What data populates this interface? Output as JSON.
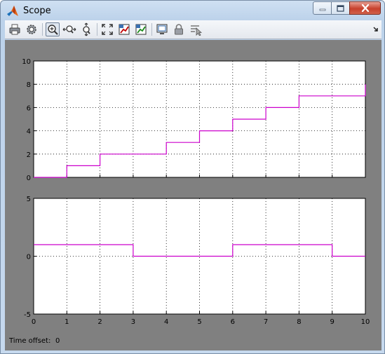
{
  "window": {
    "title": "Scope"
  },
  "toolbar": {
    "buttons": [
      {
        "icon": "print-icon"
      },
      {
        "icon": "parameters-icon"
      },
      {
        "icon": "zoom-icon"
      },
      {
        "icon": "zoom-x-icon"
      },
      {
        "icon": "zoom-y-icon"
      },
      {
        "icon": "autoscale-icon"
      },
      {
        "icon": "save-axes-icon"
      },
      {
        "icon": "restore-axes-icon"
      },
      {
        "icon": "floating-scope-icon"
      },
      {
        "icon": "lock-axes-icon"
      },
      {
        "icon": "signal-selection-icon"
      },
      {
        "icon": "dock-arrow-icon"
      }
    ]
  },
  "status": {
    "time_offset_label": "Time offset:",
    "time_offset_value": "0"
  },
  "colors": {
    "plot_background": "#ffffff",
    "figure_background": "#808080",
    "signal": "#cc00cc"
  },
  "chart_data": [
    {
      "type": "line",
      "step": true,
      "x": [
        0,
        1,
        2,
        3,
        4,
        5,
        6,
        7,
        8,
        9,
        10
      ],
      "series": [
        {
          "values": [
            0,
            1,
            2,
            2,
            3,
            4,
            5,
            6,
            7,
            7,
            8
          ]
        }
      ],
      "xlim": [
        0,
        10
      ],
      "ylim": [
        0,
        10
      ],
      "yticks": [
        "0",
        "2",
        "4",
        "6",
        "8",
        "10"
      ],
      "grid": true
    },
    {
      "type": "line",
      "step": true,
      "x": [
        0,
        1,
        2,
        3,
        4,
        5,
        6,
        7,
        8,
        9,
        10
      ],
      "series": [
        {
          "values": [
            1,
            1,
            1,
            0,
            0,
            0,
            1,
            1,
            1,
            0,
            0
          ]
        }
      ],
      "xlim": [
        0,
        10
      ],
      "ylim": [
        -5,
        5
      ],
      "yticks": [
        "-5",
        "0",
        "5"
      ],
      "xticks": [
        "0",
        "1",
        "2",
        "3",
        "4",
        "5",
        "6",
        "7",
        "8",
        "9",
        "10"
      ],
      "grid": true
    }
  ]
}
